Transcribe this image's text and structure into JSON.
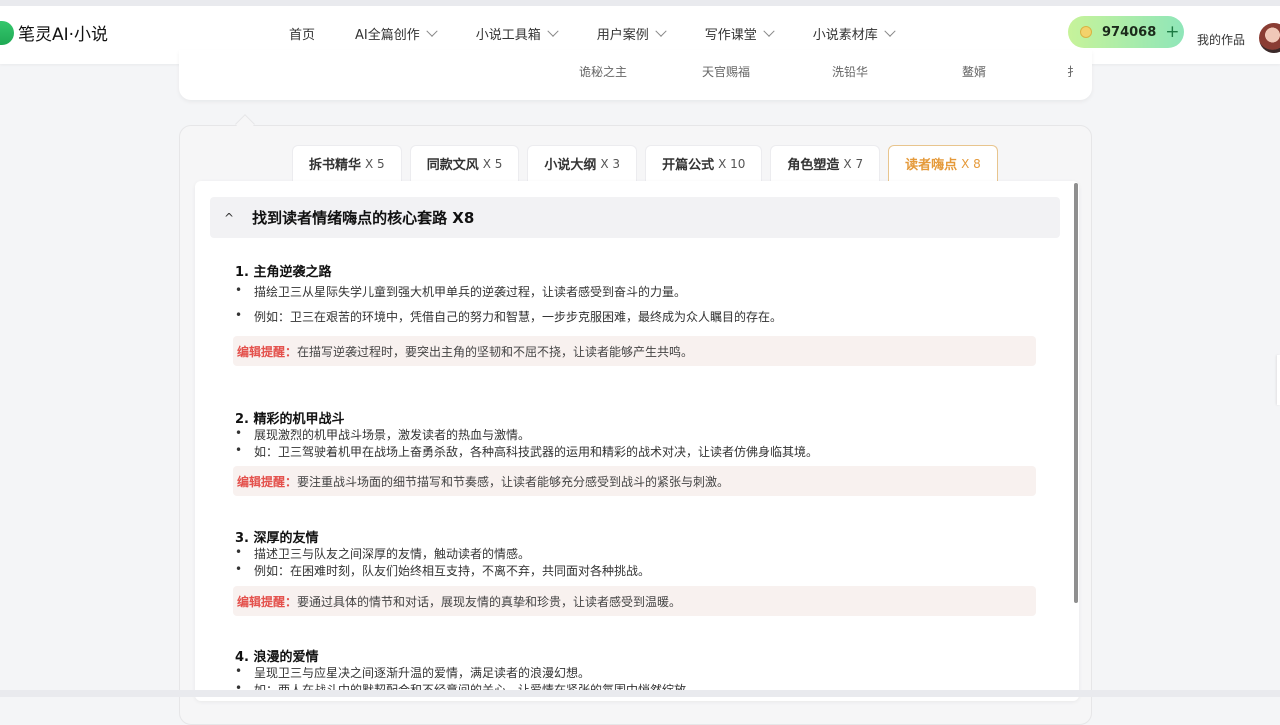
{
  "brand": {
    "name": "笔灵AI·小说"
  },
  "nav": [
    {
      "label": "首页",
      "dropdown": false
    },
    {
      "label": "AI全篇创作",
      "dropdown": true
    },
    {
      "label": "小说工具箱",
      "dropdown": true
    },
    {
      "label": "用户案例",
      "dropdown": true
    },
    {
      "label": "写作课堂",
      "dropdown": true
    },
    {
      "label": "小说素材库",
      "dropdown": true
    }
  ],
  "coins": {
    "value": "974068",
    "plus": "+"
  },
  "user": {
    "my_works": "我的作品"
  },
  "top_names": [
    "诡秘之主",
    "天官赐福",
    "洗铅华",
    "鳌婿",
    "扌"
  ],
  "tabs": [
    {
      "label": "拆书精华",
      "mult": "X 5",
      "active": false
    },
    {
      "label": "同款文风",
      "mult": "X 5",
      "active": false
    },
    {
      "label": "小说大纲",
      "mult": "X 3",
      "active": false
    },
    {
      "label": "开篇公式",
      "mult": "X 10",
      "active": false
    },
    {
      "label": "角色塑造",
      "mult": "X 7",
      "active": false
    },
    {
      "label": "读者嗨点",
      "mult": "X 8",
      "active": true
    }
  ],
  "section": {
    "caret": "^",
    "title": "找到读者情绪嗨点的核心套路 X8"
  },
  "items": [
    {
      "title": "1. 主角逆袭之路",
      "bullets": [
        "描绘卫三从星际失学儿童到强大机甲单兵的逆袭过程，让读者感受到奋斗的力量。",
        "例如：卫三在艰苦的环境中，凭借自己的努力和智慧，一步步克服困难，最终成为众人瞩目的存在。"
      ],
      "tip_label": "编辑提醒：",
      "tip": "在描写逆袭过程时，要突出主角的坚韧和不屈不挠，让读者能够产生共鸣。"
    },
    {
      "title": "2. 精彩的机甲战斗",
      "bullets": [
        "展现激烈的机甲战斗场景，激发读者的热血与激情。",
        "如：卫三驾驶着机甲在战场上奋勇杀敌，各种高科技武器的运用和精彩的战术对决，让读者仿佛身临其境。"
      ],
      "tip_label": "编辑提醒：",
      "tip": "要注重战斗场面的细节描写和节奏感，让读者能够充分感受到战斗的紧张与刺激。"
    },
    {
      "title": "3. 深厚的友情",
      "bullets": [
        "描述卫三与队友之间深厚的友情，触动读者的情感。",
        "例如：在困难时刻，队友们始终相互支持，不离不弃，共同面对各种挑战。"
      ],
      "tip_label": "编辑提醒：",
      "tip": "要通过具体的情节和对话，展现友情的真挚和珍贵，让读者感受到温暖。"
    },
    {
      "title": "4. 浪漫的爱情",
      "bullets": [
        "呈现卫三与应星决之间逐渐升温的爱情，满足读者的浪漫幻想。",
        "如：两人在战斗中的默契配合和不经意间的关心，让爱情在紧张的氛围中悄然绽放。"
      ]
    }
  ]
}
